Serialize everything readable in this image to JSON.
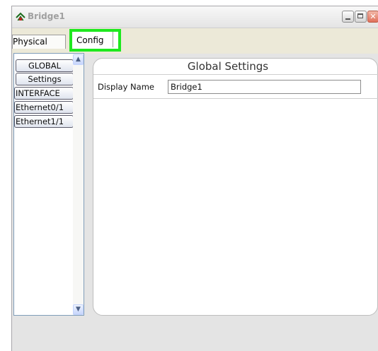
{
  "window": {
    "title": "Bridge1",
    "icon": "bridge-icon",
    "controls": [
      "minimize",
      "maximize",
      "close"
    ],
    "close_glyph": "✕"
  },
  "tabs": [
    {
      "label": "Physical",
      "selected": false
    },
    {
      "label": "Config",
      "selected": true
    }
  ],
  "sidebar": {
    "items": [
      {
        "label": "GLOBAL",
        "kind": "header"
      },
      {
        "label": "Settings",
        "kind": "item"
      },
      {
        "label": "INTERFACE",
        "kind": "header"
      },
      {
        "label": "Ethernet0/1",
        "kind": "item"
      },
      {
        "label": "Ethernet1/1",
        "kind": "item"
      }
    ],
    "scroll_up": "▲",
    "scroll_down": "▼"
  },
  "panel": {
    "title": "Global Settings",
    "display_name_label": "Display Name",
    "display_name_value": "Bridge1"
  },
  "colors": {
    "highlight": "#1ee81e"
  }
}
